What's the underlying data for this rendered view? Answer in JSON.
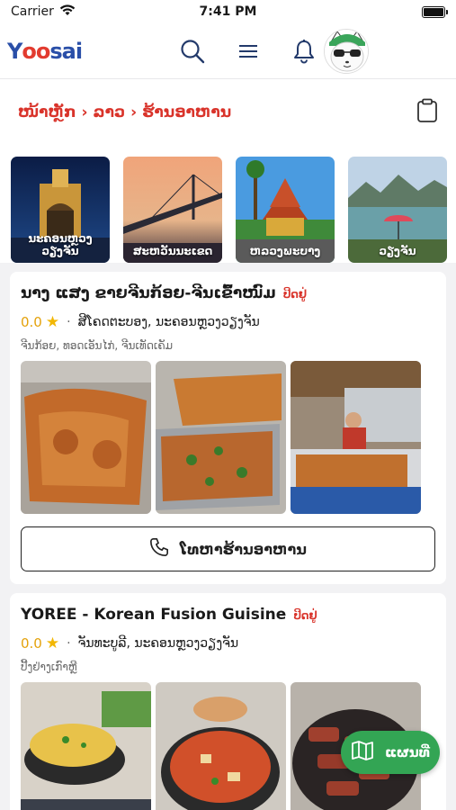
{
  "status_bar": {
    "carrier": "Carrier",
    "time": "7:41 PM"
  },
  "header": {
    "logo_part1": "Y",
    "logo_part2": "oo",
    "logo_part3": "sai",
    "icons": [
      "search-icon",
      "menu-icon",
      "bell-icon"
    ]
  },
  "breadcrumb": {
    "items": [
      "ໜ້າຫຼັກ",
      "ລາວ",
      "ຮ້ານອາຫານ"
    ],
    "separator": "›"
  },
  "cities": [
    {
      "label": "ນະຄອນຫຼວງວຽງຈັນ"
    },
    {
      "label": "ສະຫວັນນະເຂດ"
    },
    {
      "label": "ຫລວງພະບາງ"
    },
    {
      "label": "ວຽງຈັນ"
    }
  ],
  "restaurants": [
    {
      "name": "ນາງ ແສງ ຂາຍຈີນກ້ອຍ-ຈີນເຂົ້າໜົມ",
      "status": "ປິດຢູ່",
      "rating": "0.0",
      "location": "ສີໂຄດຕະບອງ, ນະຄອນຫຼວງວຽງຈັນ",
      "tags": "ຈີນກ້ອຍ, ທອດເອັນໄກ່, ຈີນເທັດເຄັມ",
      "call_label": "ໂທຫາຮ້ານອາຫານ"
    },
    {
      "name": "YOREE - Korean Fusion Guisine",
      "status": "ປິດຢູ່",
      "rating": "0.0",
      "location": "ຈັນທະບູລີ, ນະຄອນຫຼວງວຽງຈັນ",
      "tags": "ປີ້ງຢ່າງເກົາຫຼີ"
    }
  ],
  "map_button": {
    "label": "ແຜນທີ່"
  },
  "colors": {
    "accent_red": "#d9342b",
    "map_green": "#33a554",
    "star": "#f2b705"
  }
}
